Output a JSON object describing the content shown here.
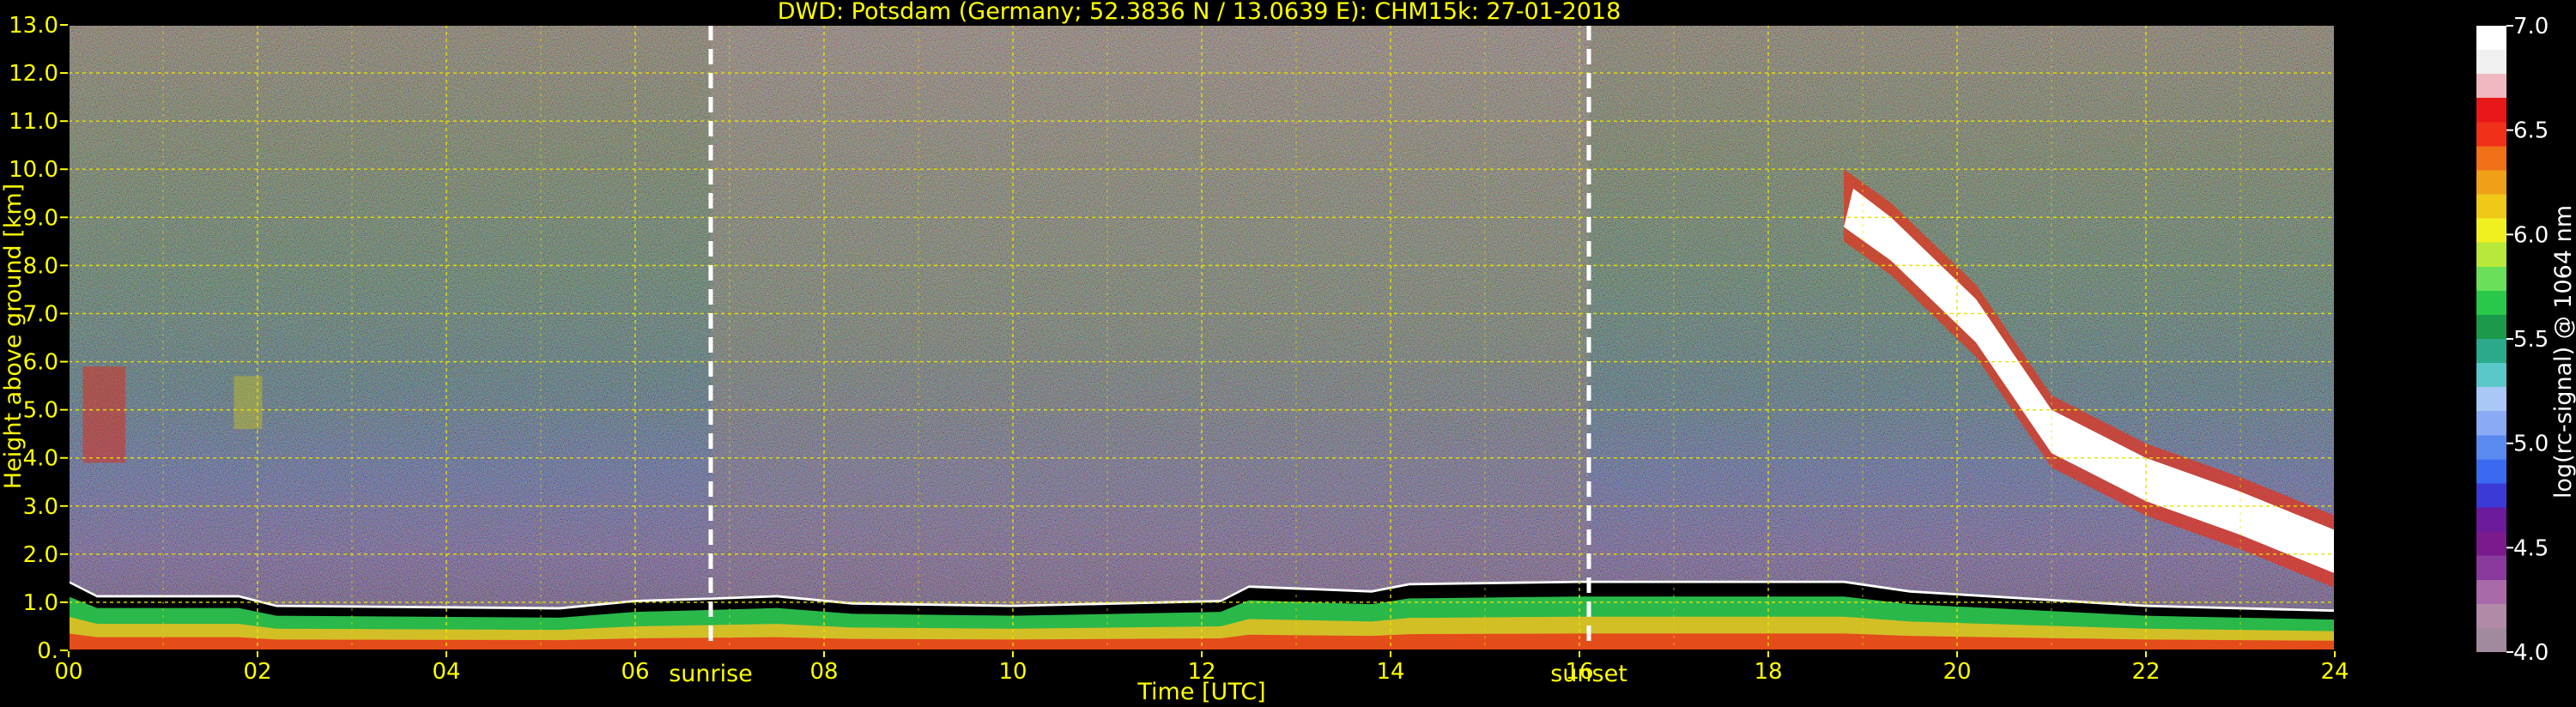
{
  "chart_data": {
    "type": "heatmap",
    "title": "DWD: Potsdam (Germany; 52.3836 N / 13.0639 E):    CHM15k: 27-01-2018",
    "xlabel": "Time [UTC]",
    "ylabel": "Height above ground [km]",
    "xlim": [
      0,
      24
    ],
    "ylim": [
      0,
      13
    ],
    "x_ticks": [
      "00",
      "02",
      "04",
      "06",
      "08",
      "10",
      "12",
      "14",
      "16",
      "18",
      "20",
      "22",
      "24"
    ],
    "x_tick_values": [
      0,
      2,
      4,
      6,
      8,
      10,
      12,
      14,
      16,
      18,
      20,
      22,
      24
    ],
    "y_ticks": [
      "0.",
      "1.0",
      "2.0",
      "3.0",
      "4.0",
      "5.0",
      "6.0",
      "7.0",
      "8.0",
      "9.0",
      "10.0",
      "11.0",
      "12.0",
      "13.0"
    ],
    "y_tick_values": [
      0,
      1,
      2,
      3,
      4,
      5,
      6,
      7,
      8,
      9,
      10,
      11,
      12,
      13
    ],
    "grid": true,
    "vertical_markers": [
      {
        "label": "sunrise",
        "time": 6.8
      },
      {
        "label": "sunset",
        "time": 16.1
      }
    ],
    "colorbar": {
      "label": "log(rc-signal) @ 1064 nm",
      "range": [
        4.0,
        7.0
      ],
      "ticks": [
        "4.0",
        "4.5",
        "5.0",
        "5.5",
        "6.0",
        "6.5",
        "7.0"
      ],
      "tick_values": [
        4.0,
        4.5,
        5.0,
        5.5,
        6.0,
        6.5,
        7.0
      ],
      "colors": [
        "#a08a9c",
        "#b18aa8",
        "#a86aa8",
        "#8a3a9c",
        "#7a1a8c",
        "#6a1a9a",
        "#3a3ad8",
        "#3a6af0",
        "#5a8af0",
        "#8aaaf5",
        "#aac8f5",
        "#5ac8c8",
        "#2aaa8a",
        "#1a9a4a",
        "#2ac84a",
        "#6ae05a",
        "#b8e83a",
        "#f0f020",
        "#f0c818",
        "#f0a018",
        "#f07018",
        "#f03018",
        "#e81818",
        "#f0b8c0",
        "#f0f0f0",
        "#ffffff"
      ]
    },
    "layers": [
      {
        "name": "boundary layer",
        "time_range": [
          0,
          24
        ],
        "height_km": [
          0.0,
          1.4
        ]
      },
      {
        "name": "cirrus cloud",
        "time_range": [
          18.8,
          24
        ],
        "top_height_km": [
          10.0,
          2.8
        ]
      },
      {
        "name": "mid-level cloud",
        "time_range": [
          0.1,
          0.6
        ],
        "height_km": [
          3.9,
          5.9
        ]
      },
      {
        "name": "mid-level cloud",
        "time_range": [
          1.7,
          2.1
        ],
        "height_km": [
          4.6,
          5.7
        ]
      }
    ]
  }
}
